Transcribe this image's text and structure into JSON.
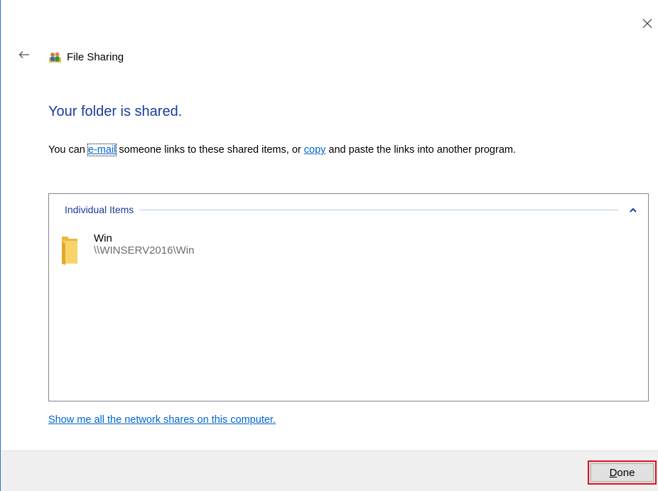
{
  "window": {
    "title": "File Sharing",
    "close_icon": "close-icon",
    "back_icon": "back-arrow-icon",
    "app_icon": "file-sharing-people-icon"
  },
  "main": {
    "heading": "Your folder is shared.",
    "desc_prefix": "You can ",
    "email_link": "e-mail",
    "desc_middle": " someone links to these shared items, or ",
    "copy_link": "copy",
    "desc_suffix": " and paste the links into another program."
  },
  "items_box": {
    "group_label": "Individual Items",
    "collapse_icon": "chevron-up-icon",
    "items": [
      {
        "name": "Win",
        "path": "\\\\WINSERV2016\\Win",
        "icon": "folder-icon"
      }
    ]
  },
  "network_shares_link": "Show me all the network shares on this computer.",
  "footer": {
    "done_mnemonic": "D",
    "done_rest": "one"
  },
  "colors": {
    "heading": "#1a3c9e",
    "link": "#0066cc",
    "highlight_border": "#e0121b",
    "footer_bg": "#f0f0f0"
  }
}
